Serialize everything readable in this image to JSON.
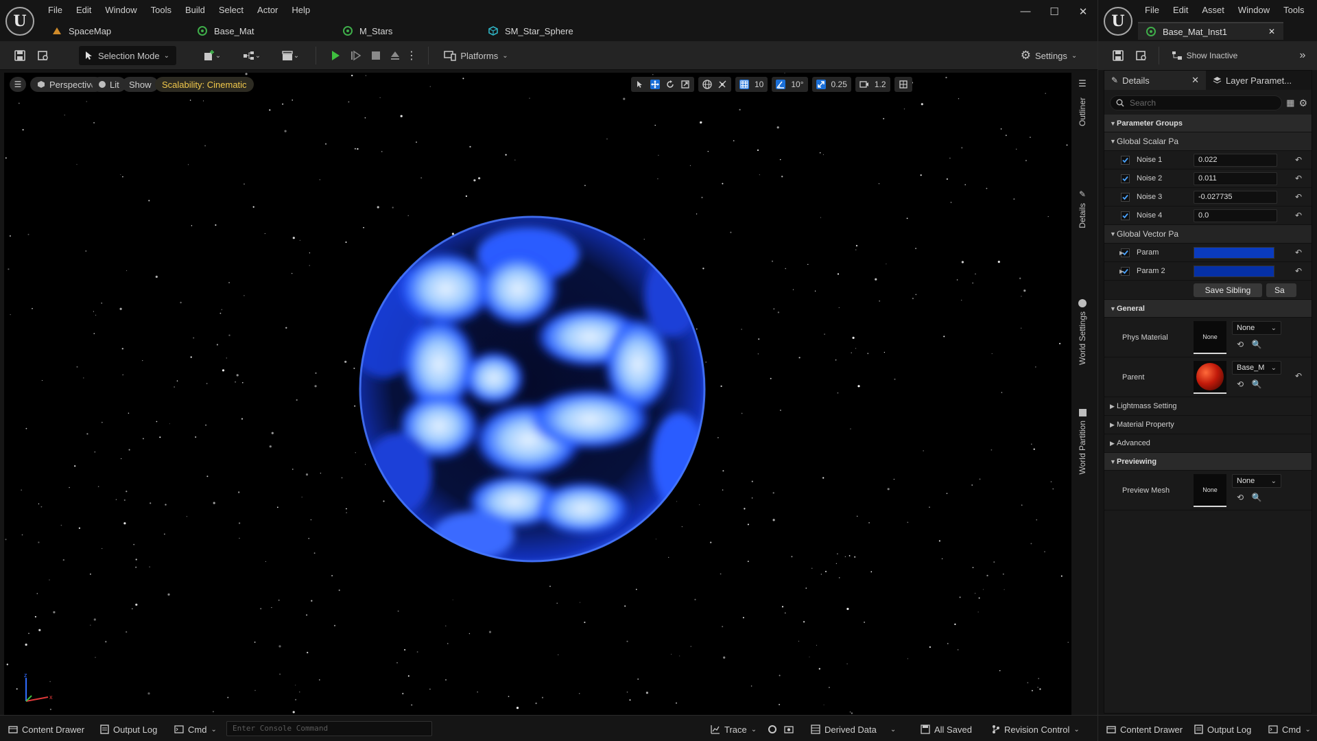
{
  "main": {
    "menu": [
      "File",
      "Edit",
      "Window",
      "Tools",
      "Build",
      "Select",
      "Actor",
      "Help"
    ],
    "tabs": [
      {
        "label": "SpaceMap",
        "icon": "level-icon"
      },
      {
        "label": "Base_Mat",
        "icon": "material-icon"
      },
      {
        "label": "M_Stars",
        "icon": "material-icon"
      },
      {
        "label": "SM_Star_Sphere",
        "icon": "static-mesh-icon"
      }
    ],
    "toolbar": {
      "selection_mode": "Selection Mode",
      "platforms": "Platforms",
      "settings": "Settings"
    },
    "viewport": {
      "perspective": "Perspective",
      "lit": "Lit",
      "show": "Show",
      "scalability": "Scalability: Cinematic",
      "grid_snap": "10",
      "rot_snap": "10°",
      "scale_snap": "0.25",
      "cam_speed": "1.2"
    },
    "side_tabs": [
      "Outliner",
      "Details",
      "World Settings",
      "World Partition"
    ],
    "status": {
      "content_drawer": "Content Drawer",
      "output_log": "Output Log",
      "cmd": "Cmd",
      "console_placeholder": "Enter Console Command",
      "trace": "Trace",
      "derived_data": "Derived Data",
      "all_saved": "All Saved",
      "revision_control": "Revision Control"
    }
  },
  "mat": {
    "menu": [
      "File",
      "Edit",
      "Asset",
      "Window",
      "Tools"
    ],
    "tab_label": "Base_Mat_Inst1",
    "show_inactive": "Show Inactive",
    "panel_tabs": {
      "details": "Details",
      "layer": "Layer Paramet..."
    },
    "search_placeholder": "Search",
    "sections": {
      "parameter_groups": "Parameter Groups",
      "global_scalar": "Global Scalar Pa",
      "global_vector": "Global Vector Pa",
      "general": "General",
      "lightmass": "Lightmass Setting",
      "material_property": "Material Property",
      "advanced": "Advanced",
      "previewing": "Previewing"
    },
    "scalars": [
      {
        "name": "Noise 1",
        "value": "0.022"
      },
      {
        "name": "Noise 2",
        "value": "0.011"
      },
      {
        "name": "Noise 3",
        "value": "-0.027735"
      },
      {
        "name": "Noise 4",
        "value": "0.0"
      }
    ],
    "vectors": [
      {
        "name": "Param",
        "color": "#0a3bbf"
      },
      {
        "name": "Param 2",
        "color": "#0530a6"
      }
    ],
    "save_sibling": "Save Sibling",
    "save_child": "Sa",
    "general": {
      "phys_material_label": "Phys Material",
      "phys_thumb": "None",
      "phys_combo": "None",
      "parent_label": "Parent",
      "parent_combo": "Base_M"
    },
    "preview": {
      "mesh_label": "Preview Mesh",
      "thumb": "None",
      "combo": "None"
    },
    "status": {
      "content_drawer": "Content Drawer",
      "output_log": "Output Log",
      "cmd": "Cmd"
    }
  }
}
